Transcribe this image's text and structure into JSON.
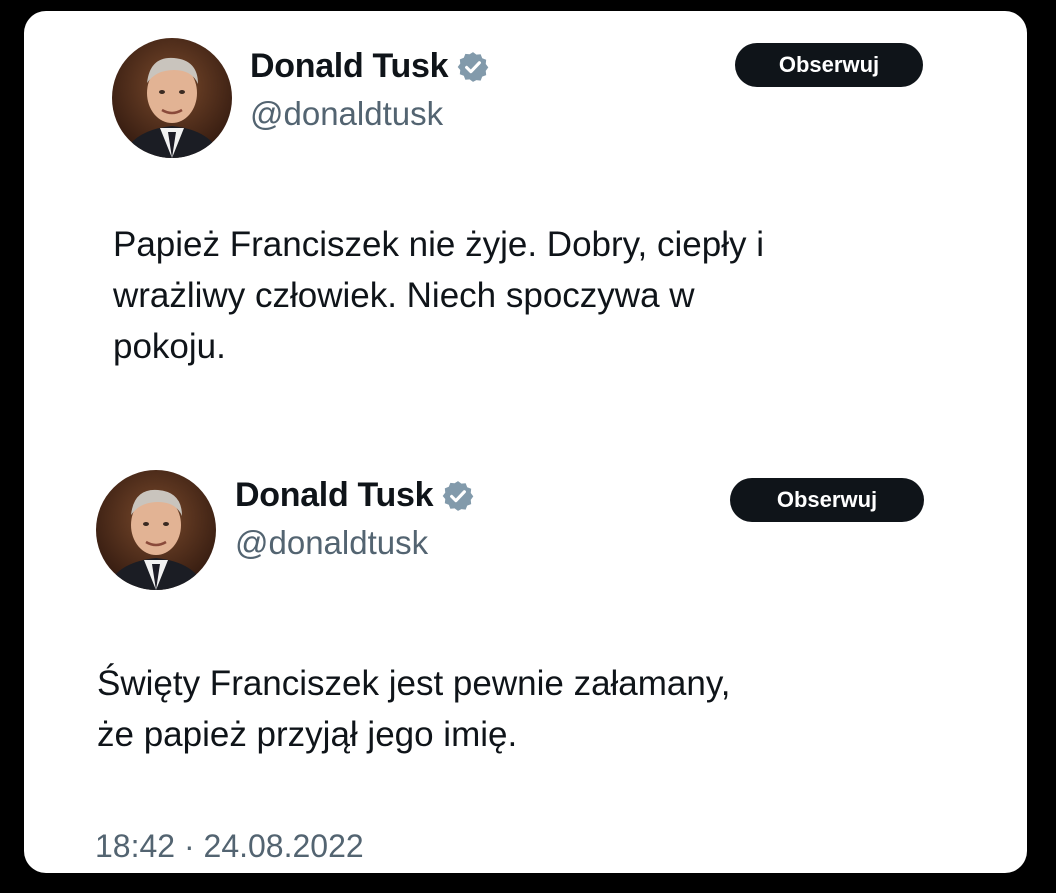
{
  "tweets": [
    {
      "author": {
        "display_name": "Donald Tusk",
        "handle": "@donaldtusk",
        "verified_icon": "verified-badge-icon"
      },
      "follow_label": "Obserwuj",
      "text": "Papież Franciszek nie żyje. Dobry, ciepły i\nwrażliwy człowiek. Niech spoczywa w\npokoju."
    },
    {
      "author": {
        "display_name": "Donald Tusk",
        "handle": "@donaldtusk",
        "verified_icon": "verified-badge-icon"
      },
      "follow_label": "Obserwuj",
      "text": "Święty Franciszek jest pewnie załamany,\nże papież przyjął jego imię."
    }
  ],
  "timestamp": "18:42 · 24.08.2022",
  "colors": {
    "page_background": "#000000",
    "card_background": "#ffffff",
    "text_primary": "#0f1419",
    "text_secondary": "#536471",
    "follow_button": "#0f1419",
    "verified_badge": "#829aab"
  }
}
